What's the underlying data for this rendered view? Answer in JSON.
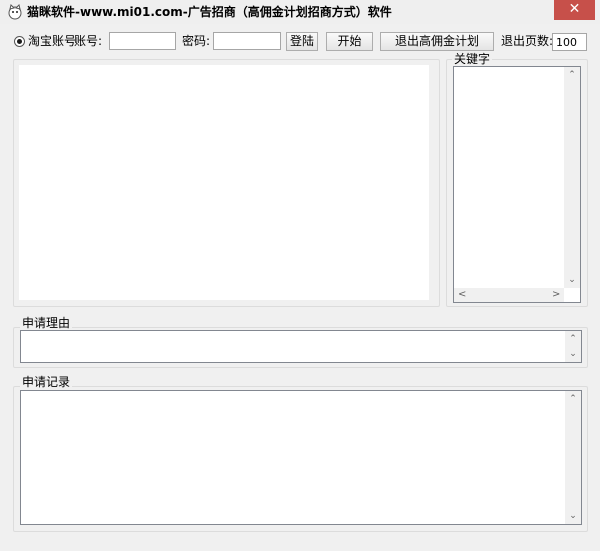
{
  "window": {
    "title": "猫眯软件-www.mi01.com-广告招商（高佣金计划招商方式）软件",
    "close_glyph": "✕"
  },
  "toolbar": {
    "taobao_account_label": "淘宝账号",
    "account_label": "账号:",
    "account_value": "",
    "password_label": "密码:",
    "password_value": "",
    "login_button": "登陆",
    "start_button": "开始",
    "exit_plan_button": "退出高佣金计划",
    "exit_pages_label": "退出页数:",
    "exit_pages_value": "100"
  },
  "keywords_panel": {
    "title": "关键字"
  },
  "reason_panel": {
    "title": "申请理由",
    "value": ""
  },
  "record_panel": {
    "title": "申请记录",
    "value": ""
  },
  "icons": {
    "up": "⌃",
    "down": "⌄",
    "left": "<",
    "right": ">"
  },
  "colors": {
    "close_button": "#c7504a"
  }
}
